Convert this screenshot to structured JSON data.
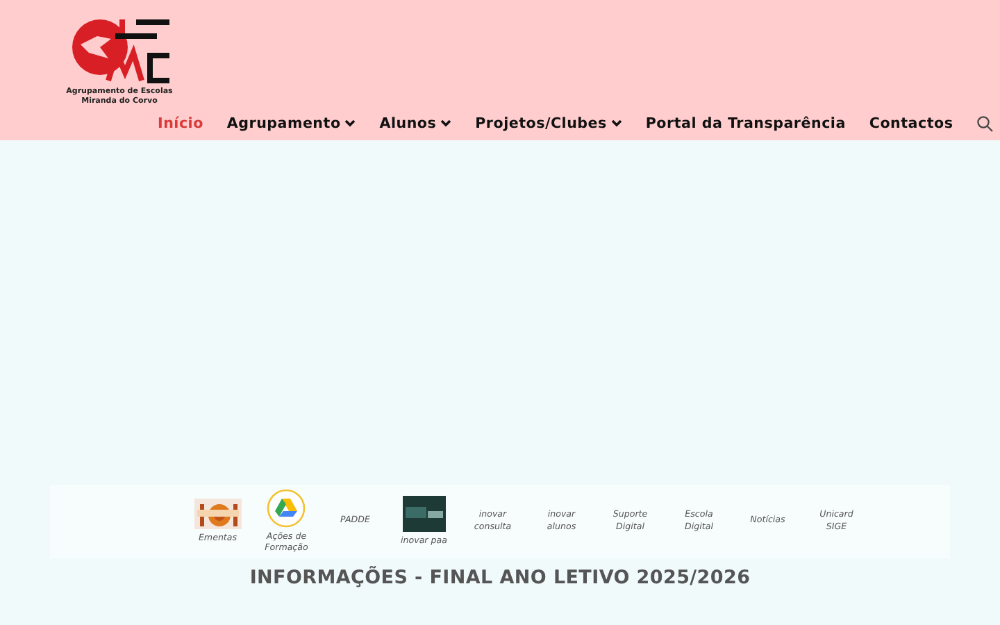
{
  "header": {
    "logo_caption": [
      "Agrupamento de Escolas",
      "Miranda do Corvo"
    ],
    "nav": [
      {
        "label": "Início",
        "selected": true,
        "dropdown": false
      },
      {
        "label": "Agrupamento",
        "selected": false,
        "dropdown": true
      },
      {
        "label": "Alunos",
        "selected": false,
        "dropdown": true
      },
      {
        "label": "Projetos/Clubes",
        "selected": false,
        "dropdown": true
      },
      {
        "label": "Portal da Transparência",
        "selected": false,
        "dropdown": false
      },
      {
        "label": "Contactos",
        "selected": false,
        "dropdown": false
      }
    ]
  },
  "links": [
    {
      "label": "Ementas"
    },
    {
      "label": "Ações de Formação",
      "kind": "drive"
    },
    {
      "label": "PADDE",
      "kind": "none"
    },
    {
      "label": "inovar paa",
      "kind": "inovar"
    },
    {
      "label": "inovar consulta",
      "kind": "none"
    },
    {
      "label": "inovar alunos",
      "kind": "none"
    },
    {
      "label": "Suporte Digital",
      "kind": "none"
    },
    {
      "label": "Escola Digital",
      "kind": "none"
    },
    {
      "label": "Notícias",
      "kind": "none"
    },
    {
      "label": "Unicard SIGE",
      "kind": "none"
    }
  ],
  "heading": "INFORMAÇÕES - FINAL ANO LETIVO 2025/2026"
}
